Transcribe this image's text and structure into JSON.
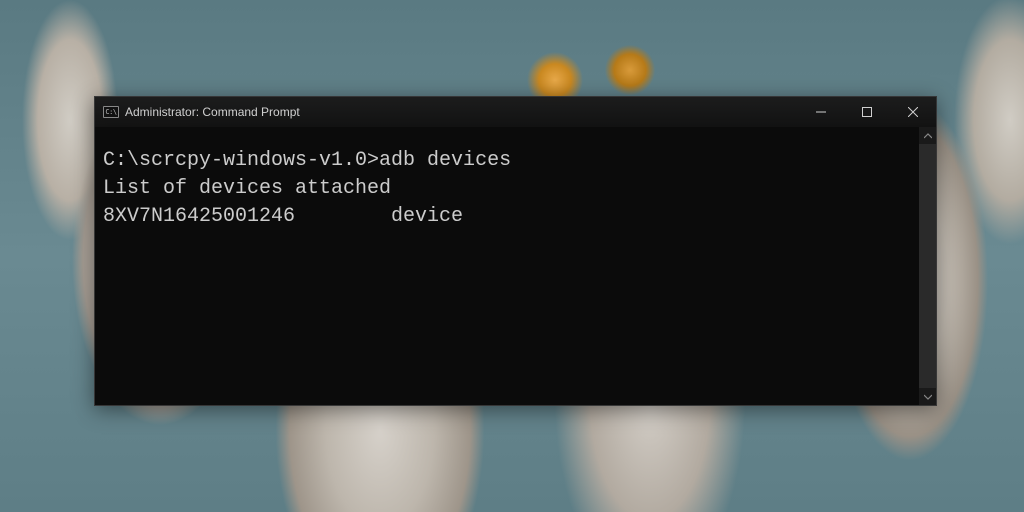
{
  "titlebar": {
    "icon_text": "C:\\",
    "title": "Administrator: Command Prompt"
  },
  "terminal": {
    "prompt": "C:\\scrcpy-windows-v1.0>",
    "command": "adb devices",
    "output_lines": [
      "List of devices attached",
      "8XV7N16425001246        device"
    ]
  },
  "colors": {
    "terminal_fg": "#cccccc",
    "terminal_bg": "#0b0b0b",
    "titlebar_fg": "#d0d0d0"
  }
}
